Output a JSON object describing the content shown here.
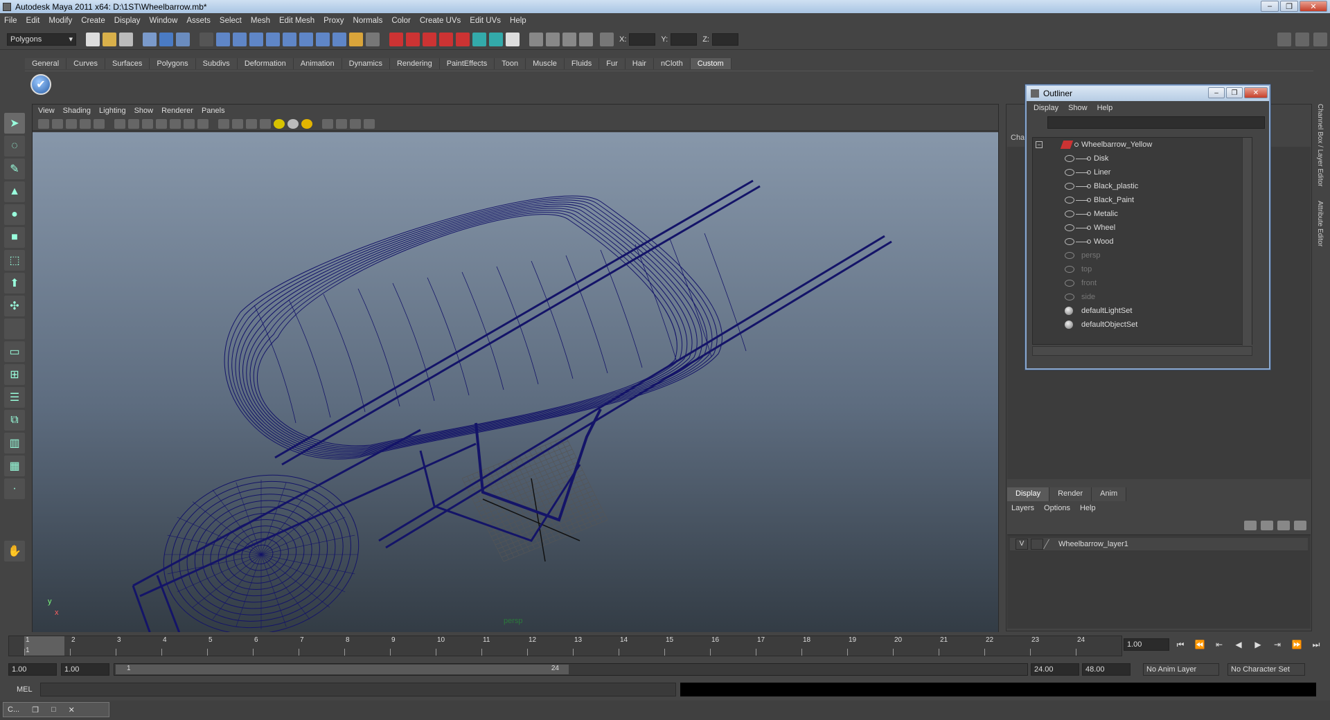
{
  "window": {
    "title": "Autodesk Maya 2011 x64: D:\\1ST\\Wheelbarrow.mb*",
    "minimize": "–",
    "maximize": "❐",
    "close": "✕"
  },
  "menubar": [
    "File",
    "Edit",
    "Modify",
    "Create",
    "Display",
    "Window",
    "Assets",
    "Select",
    "Mesh",
    "Edit Mesh",
    "Proxy",
    "Normals",
    "Color",
    "Create UVs",
    "Edit UVs",
    "Help"
  ],
  "status_line": {
    "mode": "Polygons",
    "x_label": "X:",
    "y_label": "Y:",
    "z_label": "Z:"
  },
  "shelf": {
    "tabs": [
      "General",
      "Curves",
      "Surfaces",
      "Polygons",
      "Subdivs",
      "Deformation",
      "Animation",
      "Dynamics",
      "Rendering",
      "PaintEffects",
      "Toon",
      "Muscle",
      "Fluids",
      "Fur",
      "Hair",
      "nCloth",
      "Custom"
    ],
    "active_tab": "Custom"
  },
  "viewport": {
    "menu": [
      "View",
      "Shading",
      "Lighting",
      "Show",
      "Renderer",
      "Panels"
    ],
    "camera": "persp",
    "axis_y": "y",
    "axis_x": "x",
    "wire_color": "#141468"
  },
  "outliner": {
    "title": "Outliner",
    "menu": [
      "Display",
      "Show",
      "Help"
    ],
    "root": "Wheelbarrow_Yellow",
    "children": [
      "Disk",
      "Liner",
      "Black_plastic",
      "Black_Paint",
      "Metalic",
      "Wheel",
      "Wood"
    ],
    "cameras": [
      "persp",
      "top",
      "front",
      "side"
    ],
    "sets": [
      "defaultLightSet",
      "defaultObjectSet"
    ]
  },
  "channel_box": {
    "tab_label": "Cha"
  },
  "side_tabs": [
    "Channel Box / Layer Editor",
    "Attribute Editor"
  ],
  "layer_editor": {
    "tabs": [
      "Display",
      "Render",
      "Anim"
    ],
    "active_tab": "Display",
    "menu": [
      "Layers",
      "Options",
      "Help"
    ],
    "layers": [
      {
        "visible": "V",
        "name": "Wheelbarrow_layer1"
      }
    ]
  },
  "time_slider": {
    "ticks": [
      "1",
      "2",
      "3",
      "4",
      "5",
      "6",
      "7",
      "8",
      "9",
      "10",
      "11",
      "12",
      "13",
      "14",
      "15",
      "16",
      "17",
      "18",
      "19",
      "20",
      "21",
      "22",
      "23",
      "24"
    ],
    "current_frame_marker": "1",
    "current_frame": "1.00"
  },
  "range_slider": {
    "start": "1.00",
    "playback_start": "1.00",
    "handle_start": "1",
    "handle_end": "24",
    "playback_end": "24.00",
    "end": "48.00",
    "anim_layer": "No Anim Layer",
    "character_set": "No Character Set"
  },
  "command_line": {
    "label": "MEL"
  },
  "taskbar": {
    "item": "C..."
  }
}
